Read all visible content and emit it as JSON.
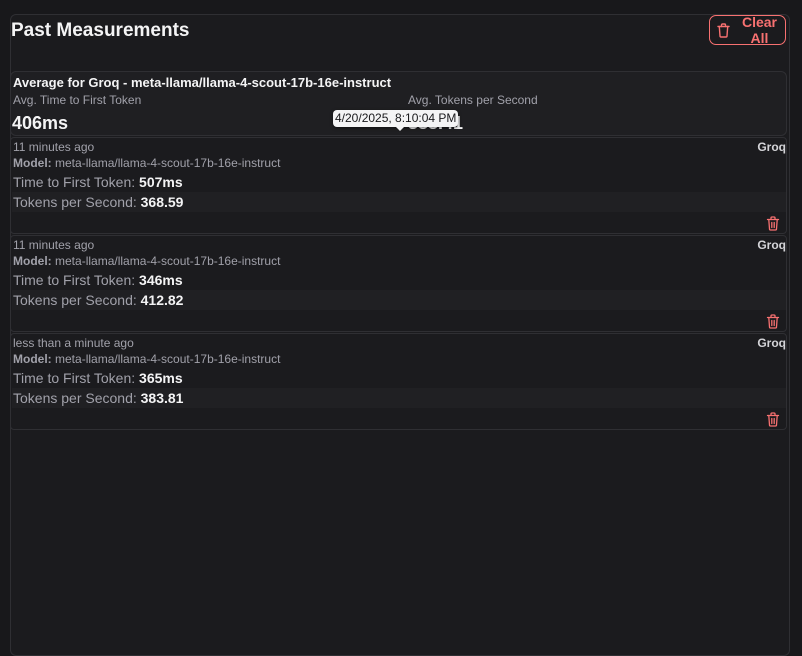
{
  "header": {
    "title": "Past Measurements",
    "clear_label": "Clear All"
  },
  "average": {
    "title": "Average for Groq - meta-llama/llama-4-scout-17b-16e-instruct",
    "ttft_label": "Avg. Time to First Token",
    "ttft_value": "406ms",
    "tps_label": "Avg. Tokens per Second",
    "tps_value": "388.41"
  },
  "tooltip": {
    "text": "4/20/2025, 8:10:04 PM"
  },
  "labels": {
    "model": "Model:",
    "ttft": "Time to First Token:",
    "tps": "Tokens per Second:"
  },
  "measurements": [
    {
      "time": "11 minutes ago",
      "provider": "Groq",
      "model": "meta-llama/llama-4-scout-17b-16e-instruct",
      "ttft": "507ms",
      "tps": "368.59"
    },
    {
      "time": "11 minutes ago",
      "provider": "Groq",
      "model": "meta-llama/llama-4-scout-17b-16e-instruct",
      "ttft": "346ms",
      "tps": "412.82"
    },
    {
      "time": "less than a minute ago",
      "provider": "Groq",
      "model": "meta-llama/llama-4-scout-17b-16e-instruct",
      "ttft": "365ms",
      "tps": "383.81"
    }
  ],
  "colors": {
    "background": "#18181b",
    "danger": "#f87171",
    "text": "#f4f4f5",
    "muted": "#a1a1aa"
  },
  "icons": {
    "clear": "trash-icon",
    "delete": "trash-icon"
  }
}
